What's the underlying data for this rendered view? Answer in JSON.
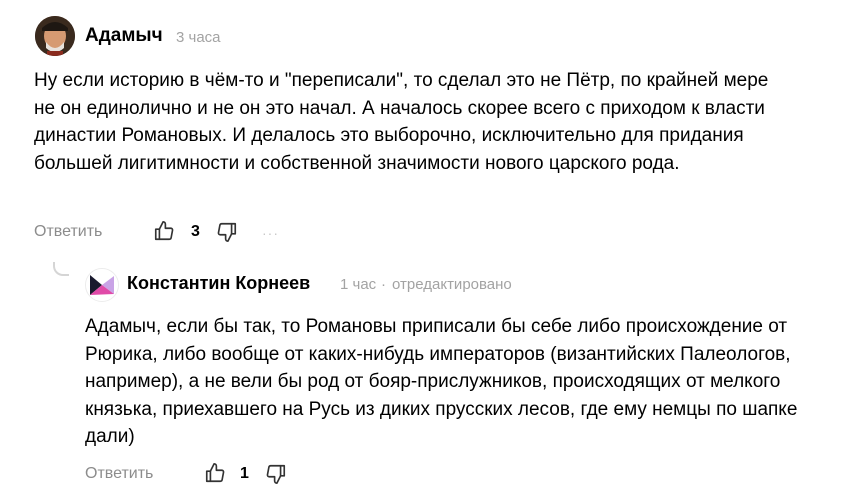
{
  "comments": [
    {
      "author": "Адамыч",
      "time": "3 часа",
      "text": "Ну если историю в чём-то и \"переписали\", то сделал это не Пётр, по крайней мере не он единолично и не он это начал. А началось скорее всего с приходом к власти династии Романовых. И делалось это выборочно, исключительно для придания большей лигитимности и собственной значимости нового царского рода.",
      "reply_label": "Ответить",
      "likes": "3",
      "more": "···"
    },
    {
      "author": "Константин Корнеев",
      "time": "1 час",
      "separator": "·",
      "edited": "отредактировано",
      "text": "Адамыч, если бы так, то Романовы приписали бы себе либо происхождение от Рюрика, либо вообще от каких-нибудь императоров (византийских Палеологов, например), а не вели бы род от бояр-прислужников, происходящих от мелкого князька, приехавшего на Русь из диких прусских лесов, где ему немцы по шапке дали)",
      "reply_label": "Ответить",
      "likes": "1"
    }
  ],
  "icons": {
    "like": "thumbs-up-icon",
    "dislike": "thumbs-down-icon",
    "more": "more-dots-icon"
  },
  "colors": {
    "text": "#000000",
    "muted": "#a3a3a3",
    "action": "#8c8c8c",
    "icon": "#333333"
  }
}
